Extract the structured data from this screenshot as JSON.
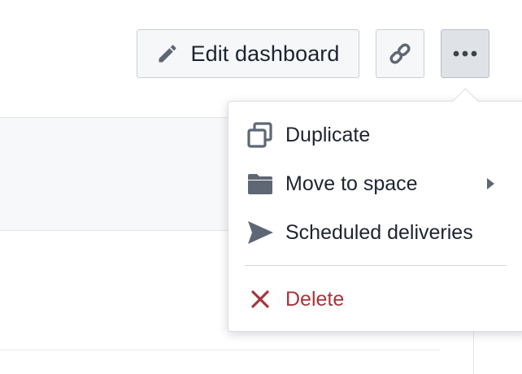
{
  "toolbar": {
    "edit_label": "Edit dashboard",
    "edit_icon": "pencil-icon",
    "link_icon": "link-icon",
    "more_icon": "ellipsis-icon"
  },
  "menu": {
    "items": [
      {
        "label": "Duplicate",
        "icon": "duplicate-icon"
      },
      {
        "label": "Move to space",
        "icon": "folder-icon",
        "has_submenu": true
      },
      {
        "label": "Scheduled deliveries",
        "icon": "send-icon"
      },
      {
        "label": "Delete",
        "icon": "close-icon",
        "color": "#a8353a"
      }
    ]
  },
  "colors": {
    "icon": "#5f6774",
    "text": "#1d2430",
    "danger": "#a8353a",
    "button_active_bg": "#dfe2e7"
  }
}
